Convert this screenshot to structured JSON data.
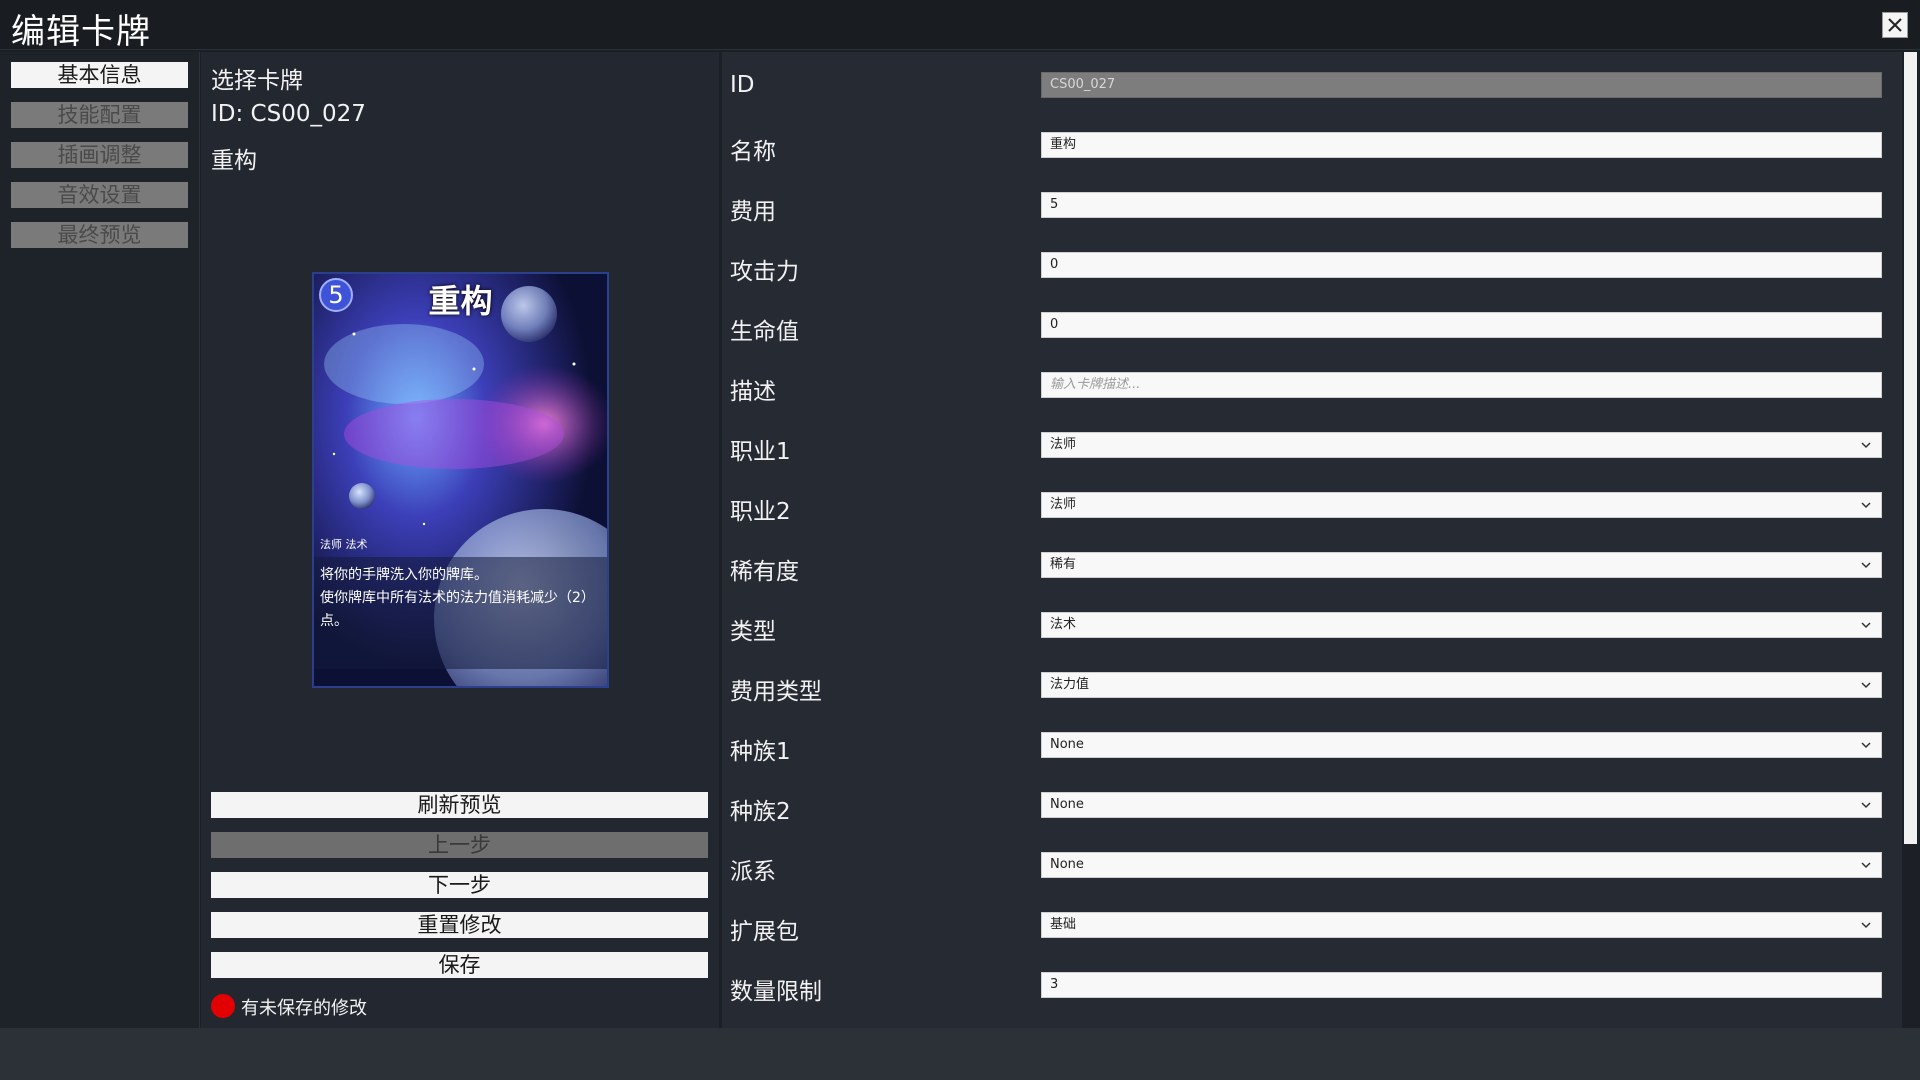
{
  "window": {
    "title": "编辑卡牌"
  },
  "nav": {
    "items": [
      {
        "label": "基本信息",
        "active": true
      },
      {
        "label": "技能配置",
        "active": false
      },
      {
        "label": "插画调整",
        "active": false
      },
      {
        "label": "音效设置",
        "active": false
      },
      {
        "label": "最终预览",
        "active": false
      }
    ]
  },
  "middle": {
    "heading": "选择卡牌",
    "id_text": "ID: CS00_027",
    "name": "重构",
    "card": {
      "cost": "5",
      "name": "重构",
      "tags": "法师 法术",
      "description": "将你的手牌洗入你的牌库。\n使你牌库中所有法术的法力值消耗减少（2）点。"
    },
    "buttons": {
      "refresh": "刷新预览",
      "prev": "上一步",
      "next": "下一步",
      "reset": "重置修改",
      "save": "保存"
    },
    "status": "有未保存的修改"
  },
  "form": {
    "fields": [
      {
        "label": "ID",
        "value": "CS00_027"
      },
      {
        "label": "名称",
        "value": "重构"
      },
      {
        "label": "费用",
        "value": "5"
      },
      {
        "label": "攻击力",
        "value": "0"
      },
      {
        "label": "生命值",
        "value": "0"
      },
      {
        "label": "描述",
        "placeholder": "输入卡牌描述..."
      },
      {
        "label": "职业1",
        "value": "法师"
      },
      {
        "label": "职业2",
        "value": "法师"
      },
      {
        "label": "稀有度",
        "value": "稀有"
      },
      {
        "label": "类型",
        "value": "法术"
      },
      {
        "label": "费用类型",
        "value": "法力值"
      },
      {
        "label": "种族1",
        "value": "None"
      },
      {
        "label": "种族2",
        "value": "None"
      },
      {
        "label": "派系",
        "value": "None"
      },
      {
        "label": "扩展包",
        "value": "基础"
      },
      {
        "label": "数量限制",
        "value": "3"
      }
    ]
  },
  "icons": [
    "close-icon",
    "chevron-down-icon"
  ]
}
